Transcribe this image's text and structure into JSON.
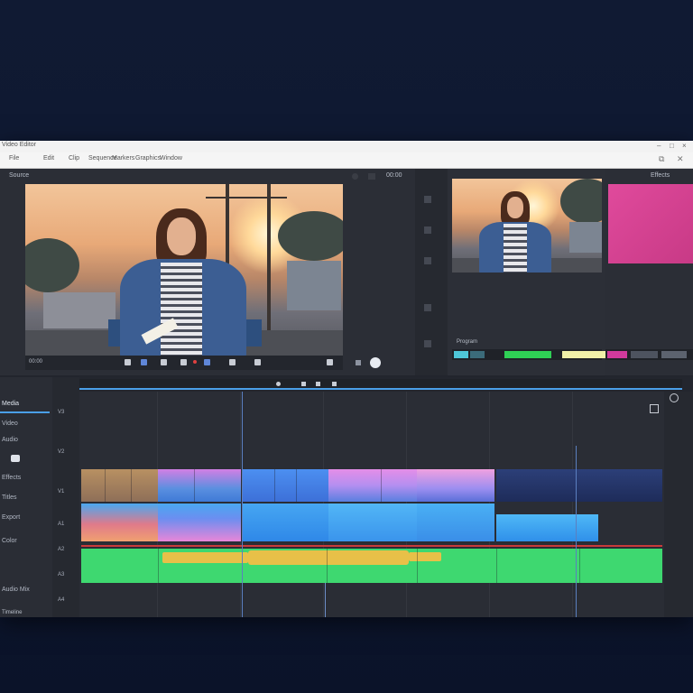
{
  "titlebar": {
    "title": "Video Editor",
    "controls": {
      "minimize": "–",
      "maximize": "□",
      "close": "×"
    }
  },
  "menubar": {
    "items": [
      "File",
      "Edit",
      "Clip",
      "Sequence",
      "Markers",
      "Graphics",
      "Window"
    ],
    "controls": {
      "restore": "⧉",
      "close": "✕"
    }
  },
  "source_monitor": {
    "header_label": "Source",
    "timecode": "00:00",
    "scene": "woman in denim jacket and striped shirt holding a notebook at sunset"
  },
  "program_monitor": {
    "header_label": "Program"
  },
  "effects_panel": {
    "header_label": "Effects",
    "swatch_color": "#e04a9c"
  },
  "timeline": {
    "sidebar_items": [
      "Media",
      "Video",
      "Audio",
      "Effects",
      "Titles",
      "Export",
      "Color",
      "Audio Mix"
    ],
    "track_labels": [
      "V3",
      "V2",
      "V1",
      "A1",
      "A2",
      "A3",
      "A4"
    ],
    "colors": {
      "accent": "#4a9fe8",
      "playhead": "#5b7fc0",
      "audio": "#3ed870",
      "pink": "#e886d8",
      "blue": "#4aa8f0"
    }
  },
  "bottom_label": "Timeline"
}
